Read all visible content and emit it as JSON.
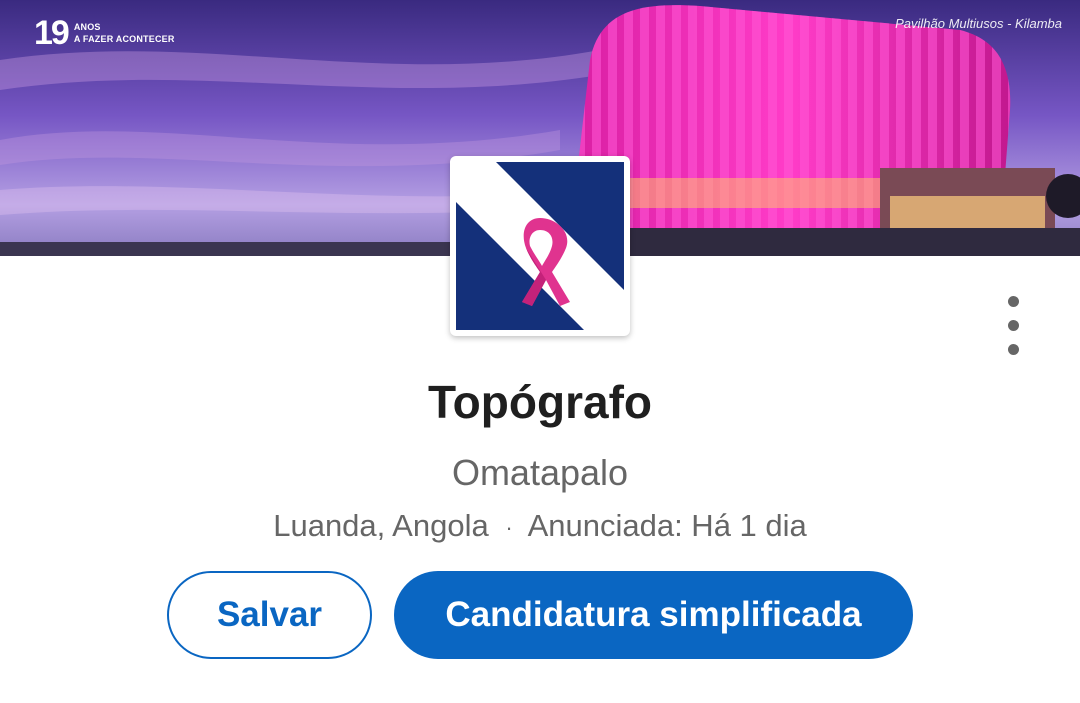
{
  "cover": {
    "badge_number": "19",
    "badge_line1": "ANOS",
    "badge_line2": "A FAZER ACONTECER",
    "caption": "Pavilhão Multiusos - Kilamba"
  },
  "company": {
    "logo_icon": "pink-ribbon-logo-icon",
    "name": "Omatapalo"
  },
  "job": {
    "title": "Topógrafo",
    "location": "Luanda, Angola",
    "separator": "·",
    "posted": "Anunciada: Há 1 dia"
  },
  "actions": {
    "save_label": "Salvar",
    "apply_label": "Candidatura simplificada",
    "menu_icon": "more-vertical-icon"
  },
  "colors": {
    "accent": "#0a66c2",
    "ribbon": "#e0338f",
    "logo_bg": "#14307a"
  }
}
